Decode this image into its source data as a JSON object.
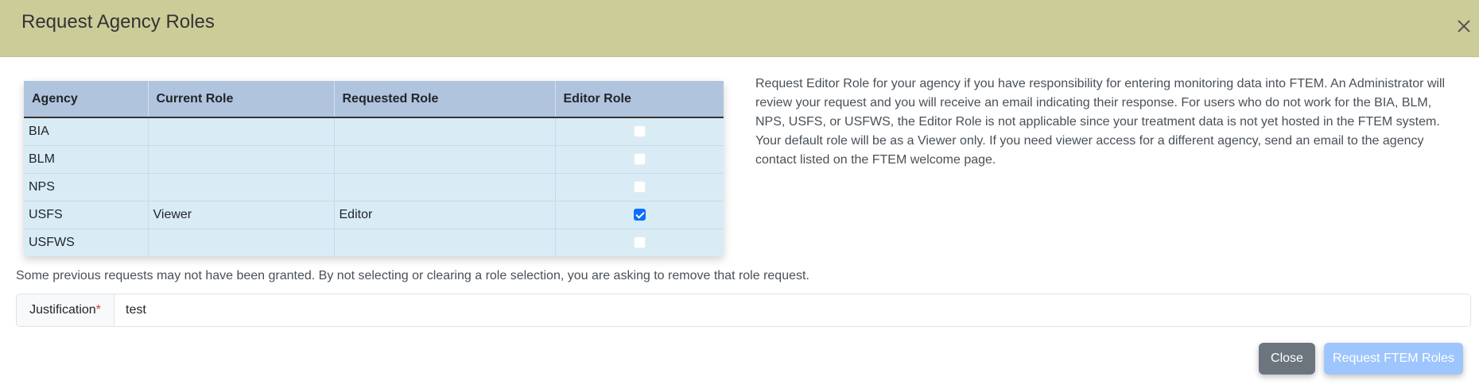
{
  "modal": {
    "title": "Request Agency Roles",
    "close_icon": "close-icon"
  },
  "table": {
    "headers": [
      "Agency",
      "Current Role",
      "Requested Role",
      "Editor Role"
    ],
    "rows": [
      {
        "agency": "BIA",
        "current_role": "",
        "requested_role": "",
        "editor_checked": false
      },
      {
        "agency": "BLM",
        "current_role": "",
        "requested_role": "",
        "editor_checked": false
      },
      {
        "agency": "NPS",
        "current_role": "",
        "requested_role": "",
        "editor_checked": false
      },
      {
        "agency": "USFS",
        "current_role": "Viewer",
        "requested_role": "Editor",
        "editor_checked": true
      },
      {
        "agency": "USFWS",
        "current_role": "",
        "requested_role": "",
        "editor_checked": false
      }
    ]
  },
  "info": {
    "text": "Request Editor Role for your agency if you have responsibility for entering monitoring data into FTEM. An Administrator will review your request and you will receive an email indicating their response. For users who do not work for the BIA, BLM, NPS, USFS, or USFWS, the Editor Role is not applicable since your treatment data is not yet hosted in the FTEM system. Your default role will be as a Viewer only. If you need viewer access for a different agency, send an email to the agency contact listed on the FTEM welcome page."
  },
  "note": {
    "text": "Some previous requests may not have been granted. By not selecting or clearing a role selection, you are asking to remove that role request."
  },
  "justification": {
    "label": "Justification",
    "required_marker": "*",
    "value": "test"
  },
  "footer": {
    "close_label": "Close",
    "request_label": "Request FTEM Roles"
  },
  "colors": {
    "header_bg": "#cccc99",
    "table_header_bg": "#b0c4de",
    "table_row_bg": "#d9ecf5",
    "checkbox_checked": "#0d6efd",
    "close_button": "#6c757d",
    "request_button_disabled": "#9ec5fe"
  }
}
